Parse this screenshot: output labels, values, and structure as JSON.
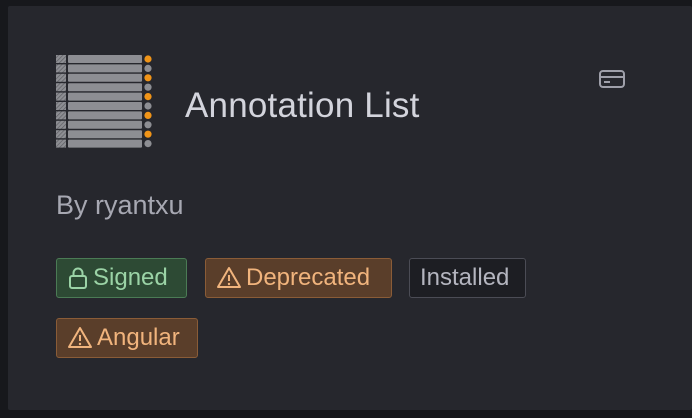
{
  "plugin": {
    "title": "Annotation List",
    "author": "By ryantxu",
    "logo_icon": "annotation-list-logo",
    "type_icon": "card-icon"
  },
  "badges": {
    "signed": "Signed",
    "deprecated": "Deprecated",
    "installed": "Installed",
    "angular": "Angular"
  },
  "colors": {
    "card_background": "#26272d",
    "page_background": "#17181c",
    "signed": "#9bd3a6",
    "warning": "#f1b47d",
    "installed": "#b4b5bf",
    "logo_accent": "#f09418"
  }
}
